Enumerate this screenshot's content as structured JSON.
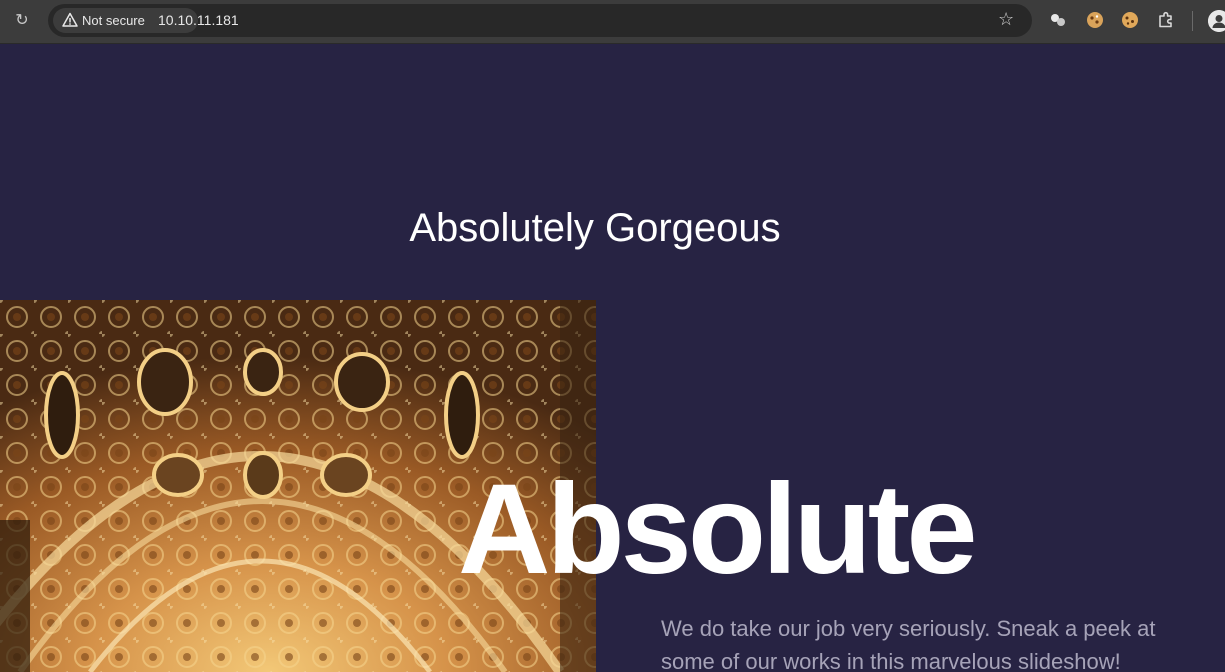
{
  "browser": {
    "security_label": "Not secure",
    "url": "10.10.11.181",
    "icons": [
      "reload-icon",
      "warning-icon",
      "bookmark-star-icon",
      "extension-puzzle-icon",
      "cookie-icon",
      "profile-icon"
    ]
  },
  "page": {
    "hero_title": "Absolutely Gorgeous",
    "headline": "Absolute",
    "description": "We do take our job very seriously. Sneak a peek at some of our works in this marvelous slideshow!"
  },
  "colors": {
    "page_background": "#272343",
    "text_primary": "#ffffff",
    "text_muted": "#a6a3b8"
  }
}
